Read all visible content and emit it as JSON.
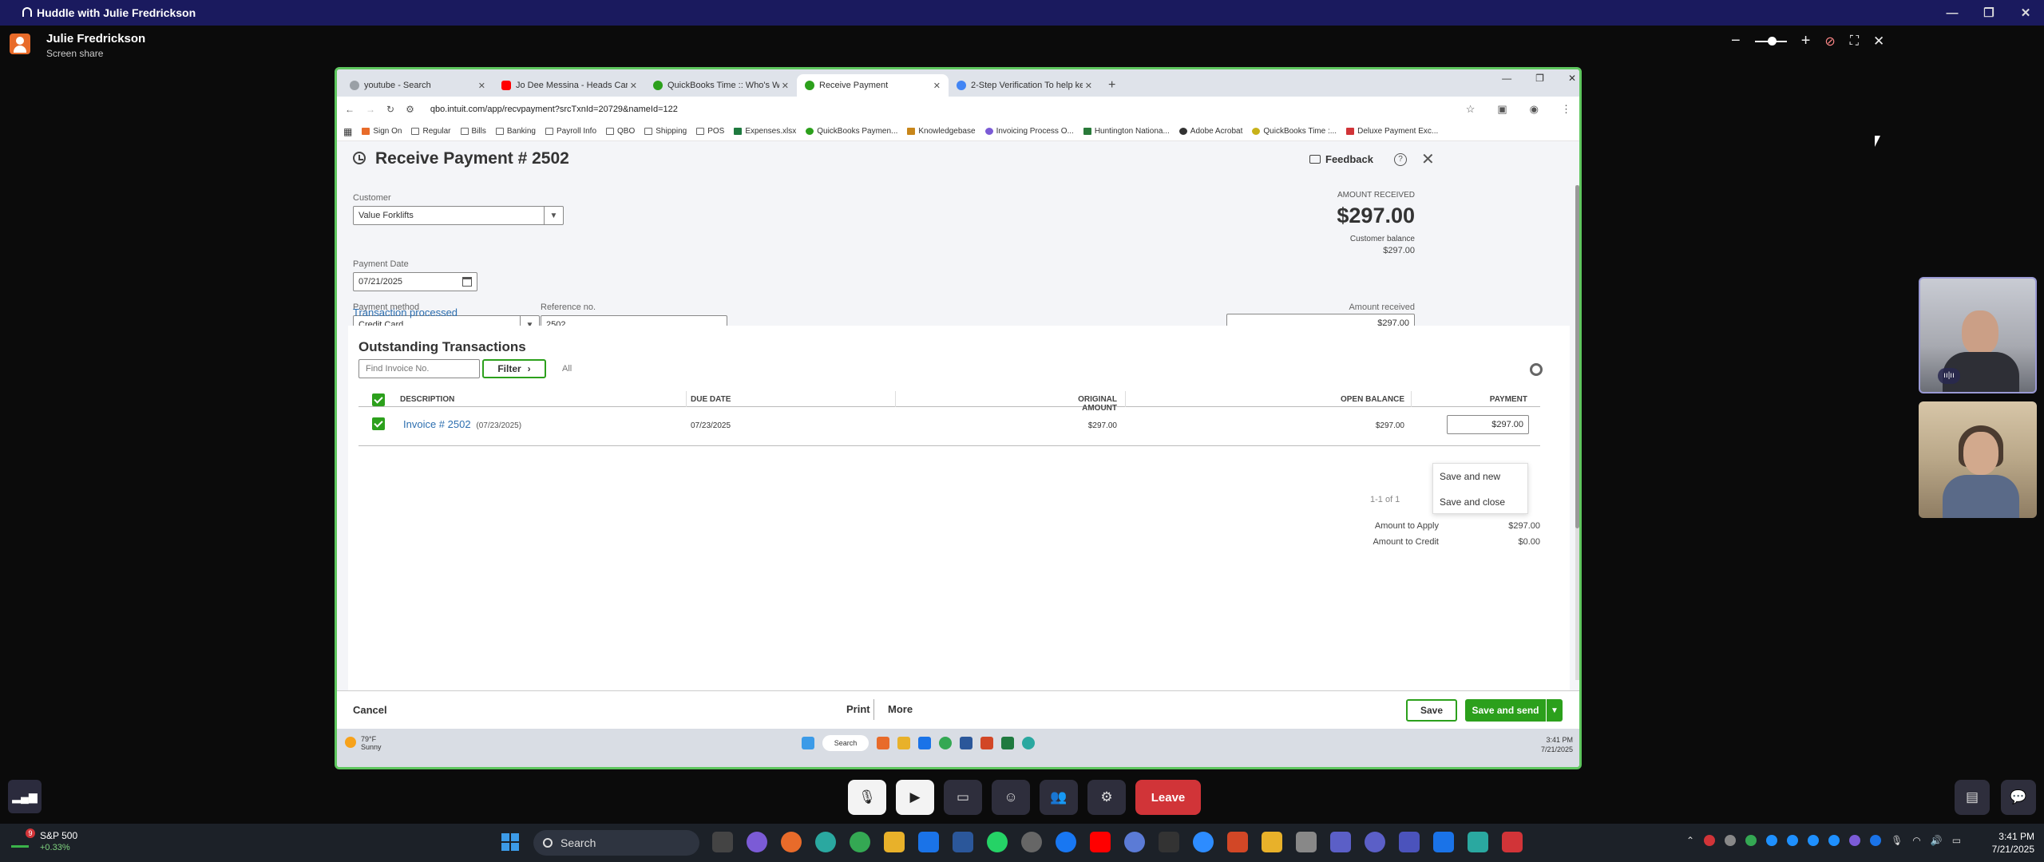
{
  "teams": {
    "window_title": "Huddle with Julie Fredrickson",
    "presenter_name": "Julie Fredrickson",
    "presenter_status": "Screen share",
    "leave_label": "Leave"
  },
  "browser": {
    "tabs": [
      {
        "label": "youtube - Search",
        "color": "#9aa0a6"
      },
      {
        "label": "Jo Dee Messina - Heads Carolina",
        "color": "#ff0000"
      },
      {
        "label": "QuickBooks Time :: Who's Working",
        "color": "#2ca01c"
      },
      {
        "label": "Receive Payment",
        "color": "#2ca01c",
        "active": true
      },
      {
        "label": "2-Step Verification To help keep",
        "color": "#4285f4"
      }
    ],
    "url": "qbo.intuit.com/app/recvpayment?srcTxnId=20729&nameId=122",
    "bookmarks": [
      "Sign On",
      "Regular",
      "Bills",
      "Banking",
      "Payroll Info",
      "QBO",
      "Shipping",
      "POS",
      "Expenses.xlsx",
      "QuickBooks Paymen...",
      "Knowledgebase",
      "Invoicing Process O...",
      "Huntington Nationa...",
      "Adobe Acrobat",
      "QuickBooks Time :...",
      "Deluxe Payment Exc..."
    ]
  },
  "qbo": {
    "page_title": "Receive Payment # 2502",
    "feedback_label": "Feedback",
    "customer_label": "Customer",
    "customer_value": "Value Forklifts",
    "amount_received_label": "AMOUNT RECEIVED",
    "amount_received_big": "$297.00",
    "customer_balance_label": "Customer balance",
    "customer_balance_value": "$297.00",
    "payment_date_label": "Payment Date",
    "payment_date_value": "07/21/2025",
    "payment_method_label": "Payment method",
    "payment_method_value": "Credit Card",
    "reference_label": "Reference no.",
    "reference_value": "2502",
    "amount_received_field_label": "Amount received",
    "amount_received_field_value": "$297.00",
    "transaction_status": "Transaction processed",
    "outstanding": {
      "title": "Outstanding Transactions",
      "find_placeholder": "Find Invoice No.",
      "filter_label": "Filter",
      "all_label": "All",
      "columns": [
        "DESCRIPTION",
        "DUE DATE",
        "ORIGINAL AMOUNT",
        "OPEN BALANCE",
        "PAYMENT"
      ],
      "rows": [
        {
          "description": "Invoice # 2502",
          "date_note": "(07/23/2025)",
          "due_date": "07/23/2025",
          "original_amount": "$297.00",
          "open_balance": "$297.00",
          "payment": "$297.00"
        }
      ],
      "pager_text": "1-1 of 1",
      "pager_current": "1"
    },
    "amount_to_apply_label": "Amount to Apply",
    "amount_to_apply_value": "$297.00",
    "amount_to_credit_label": "Amount to Credit",
    "amount_to_credit_value": "$0.00",
    "save_menu": [
      "Save and new",
      "Save and close"
    ],
    "footer": {
      "cancel": "Cancel",
      "print": "Print",
      "more": "More",
      "save": "Save",
      "save_and_send": "Save and send"
    }
  },
  "inner_taskbar": {
    "weather_temp": "79°F",
    "weather_desc": "Sunny",
    "search_label": "Search",
    "time": "3:41 PM",
    "date": "7/21/2025"
  },
  "windows_taskbar": {
    "stock_name": "S&P 500",
    "stock_change": "+0.33%",
    "stock_badge": "9",
    "search_label": "Search",
    "time": "3:41 PM",
    "date": "7/21/2025"
  }
}
